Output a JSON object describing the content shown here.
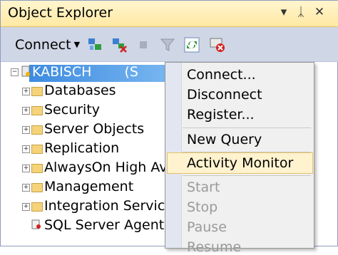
{
  "window": {
    "title": "Object Explorer",
    "pin_glyph": "ᛣ",
    "close_glyph": "✕",
    "dropdown_glyph": "▾"
  },
  "toolbar": {
    "connect_label": "Connect"
  },
  "tree": {
    "server_label": "KABISCH",
    "server_suffix": "(S",
    "items": [
      {
        "label": "Databases"
      },
      {
        "label": "Security"
      },
      {
        "label": "Server Objects"
      },
      {
        "label": "Replication"
      },
      {
        "label": "AlwaysOn High Avai"
      },
      {
        "label": "Management"
      },
      {
        "label": "Integration Services"
      },
      {
        "label": "SQL Server Agent (A"
      }
    ]
  },
  "menu": {
    "items": [
      {
        "label": "Connect..."
      },
      {
        "label": "Disconnect"
      },
      {
        "label": "Register..."
      },
      {
        "label": "New Query"
      },
      {
        "label": "Activity Monitor"
      },
      {
        "label": "Start"
      },
      {
        "label": "Stop"
      },
      {
        "label": "Pause"
      },
      {
        "label": "Resume"
      }
    ]
  },
  "colors": {
    "title_bg": "#ffe9a3",
    "toolbar_bg": "#cfd6e5",
    "selection": "#3d8be0",
    "menu_hover": "#fff3cf"
  }
}
